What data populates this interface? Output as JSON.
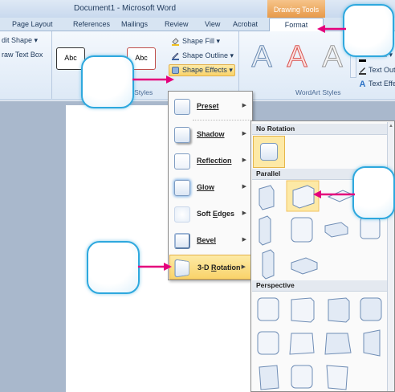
{
  "window": {
    "title": "Document1 - Microsoft Word",
    "contextual_tab": "Drawing Tools"
  },
  "tabs": [
    "Page Layout",
    "References",
    "Mailings",
    "Review",
    "View",
    "Acrobat"
  ],
  "active_tab": "Format",
  "ribbon": {
    "left_items": [
      "dit Shape ▾",
      "raw Text Box"
    ],
    "abc_label": "Abc",
    "shape_fill": "Shape Fill ▾",
    "shape_outline": "Shape Outline ▾",
    "shape_effects": "Shape Effects ▾",
    "shape_styles_group": "e Styles",
    "wordart_group": "WordArt Styles",
    "text_fill": "ill ▾",
    "text_outline": "Text Outl",
    "text_effects": "Text Effe",
    "wordart_letter": "A"
  },
  "menu": {
    "items": [
      {
        "label": "Preset",
        "mnemonic_index": 0
      },
      {
        "label": "Shadow",
        "mnemonic_index": 0
      },
      {
        "label": "Reflection",
        "mnemonic_index": 0
      },
      {
        "label": "Glow",
        "mnemonic_index": 0
      },
      {
        "label": "Soft Edges",
        "mnemonic_index": 5
      },
      {
        "label": "Bevel",
        "mnemonic_index": 0
      },
      {
        "label": "3-D Rotation",
        "mnemonic_index": 4
      }
    ],
    "highlighted": "3-D Rotation"
  },
  "submenu": {
    "sections": [
      "No Rotation",
      "Parallel",
      "Perspective"
    ]
  },
  "colors": {
    "callout_border": "#2ea8de",
    "arrow": "#e4007c",
    "highlight": "#fde9a6",
    "contextual_tab": "#e79a4a"
  }
}
